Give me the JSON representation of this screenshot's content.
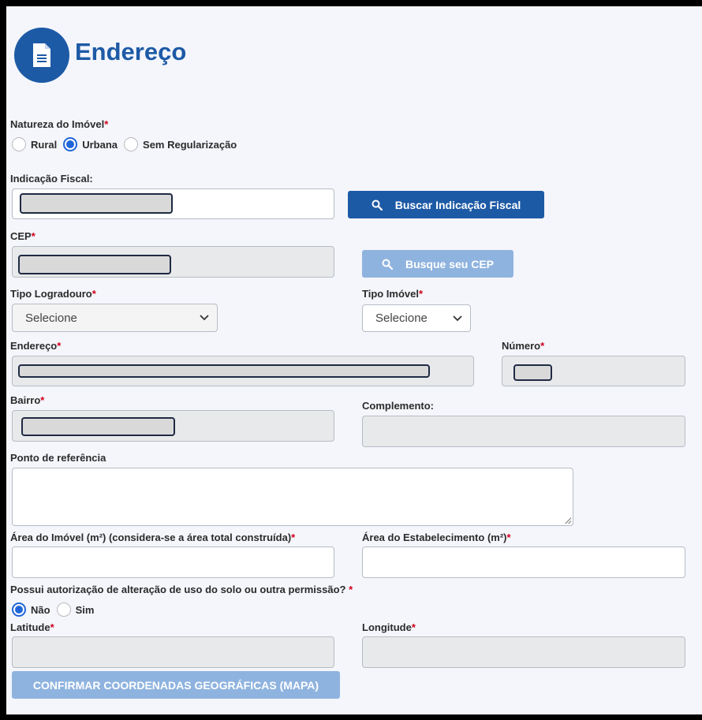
{
  "header": {
    "title": "Endereço",
    "icon": "document-icon",
    "accent_color": "#1d5aa6"
  },
  "natureza": {
    "label": "Natureza do Imóvel",
    "required_mark": "*",
    "options": [
      {
        "label": "Rural",
        "checked": false
      },
      {
        "label": "Urbana",
        "checked": true
      },
      {
        "label": "Sem Regularização",
        "checked": false
      }
    ]
  },
  "indicacao_fiscal": {
    "label": "Indicação Fiscal:",
    "button_label": "Buscar Indicação Fiscal"
  },
  "cep": {
    "label": "CEP",
    "required_mark": "*",
    "button_label": "Busque seu CEP"
  },
  "tipo_logradouro": {
    "label": "Tipo Logradouro",
    "required_mark": "*",
    "selected": "Selecione"
  },
  "tipo_imovel": {
    "label": "Tipo Imóvel",
    "required_mark": "*",
    "selected": "Selecione"
  },
  "endereco": {
    "label": "Endereço",
    "required_mark": "*"
  },
  "numero": {
    "label": "Número",
    "required_mark": "*"
  },
  "bairro": {
    "label": "Bairro",
    "required_mark": "*"
  },
  "complemento": {
    "label": "Complemento:"
  },
  "ponto_referencia": {
    "label": "Ponto de referência"
  },
  "area_imovel": {
    "label": "Área do Imóvel (m²) (considera-se a área total construída)",
    "required_mark": "*"
  },
  "area_estabelecimento": {
    "label": "Área do Estabelecimento (m²)",
    "required_mark": "*"
  },
  "autorizacao": {
    "label": "Possui autorização de alteração de uso do solo ou outra permissão?",
    "required_mark": " *",
    "options": [
      {
        "label": "Não",
        "checked": true
      },
      {
        "label": "Sim",
        "checked": false
      }
    ]
  },
  "latitude": {
    "label": "Latitude",
    "required_mark": "*"
  },
  "longitude": {
    "label": "Longitude",
    "required_mark": "*"
  },
  "confirm_button": {
    "label": "CONFIRMAR COORDENADAS GEOGRÁFICAS (MAPA)"
  }
}
